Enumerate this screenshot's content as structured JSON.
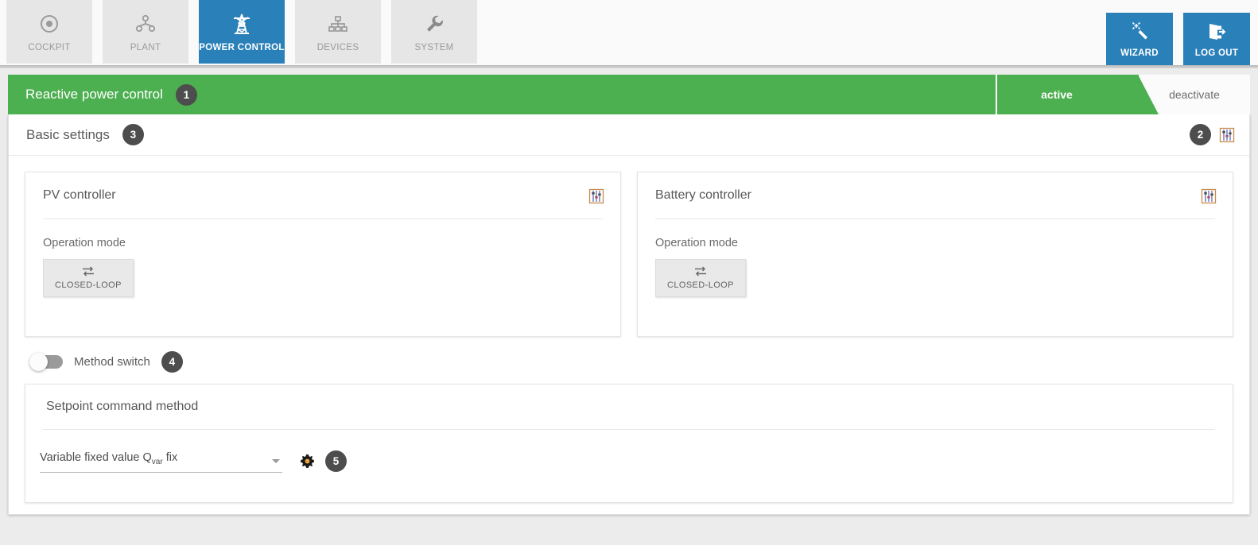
{
  "nav": {
    "tabs": [
      {
        "label": "COCKPIT",
        "icon": "target-icon",
        "active": false
      },
      {
        "label": "PLANT",
        "icon": "plant-network-icon",
        "active": false
      },
      {
        "label": "POWER CONTROL",
        "icon": "power-tower-icon",
        "active": true
      },
      {
        "label": "DEVICES",
        "icon": "devices-hierarchy-icon",
        "active": false
      },
      {
        "label": "SYSTEM",
        "icon": "wrench-icon",
        "active": false
      }
    ],
    "actions": [
      {
        "label": "WIZARD",
        "icon": "magic-wand-icon"
      },
      {
        "label": "LOG OUT",
        "icon": "logout-icon"
      }
    ]
  },
  "header": {
    "title": "Reactive power control",
    "badge": "1",
    "state_active_label": "active",
    "state_deactivate_label": "deactivate"
  },
  "basic_settings": {
    "title": "Basic settings",
    "badge": "3",
    "toolbar_badge": "2",
    "toolbar_icon": "equalizer-icon"
  },
  "controllers": [
    {
      "title": "PV controller",
      "icon": "equalizer-icon",
      "operation_mode_label": "Operation mode",
      "mode_button_label": "CLOSED-LOOP",
      "mode_button_icon": "loop-arrows-icon"
    },
    {
      "title": "Battery controller",
      "icon": "equalizer-icon",
      "operation_mode_label": "Operation mode",
      "mode_button_label": "CLOSED-LOOP",
      "mode_button_icon": "loop-arrows-icon"
    }
  ],
  "method_switch": {
    "label": "Method switch",
    "badge": "4",
    "state": "off"
  },
  "setpoint": {
    "title": "Setpoint command method",
    "select_value_prefix": "Variable fixed value Q",
    "select_value_sub": "var",
    "select_value_suffix": " fix",
    "gear_icon": "gear-icon",
    "badge": "5"
  },
  "colors": {
    "accent_blue": "#2a80b9",
    "accent_green": "#4caf50",
    "badge_dark": "#4d4d4d",
    "gear_orange": "#e8a33d"
  }
}
